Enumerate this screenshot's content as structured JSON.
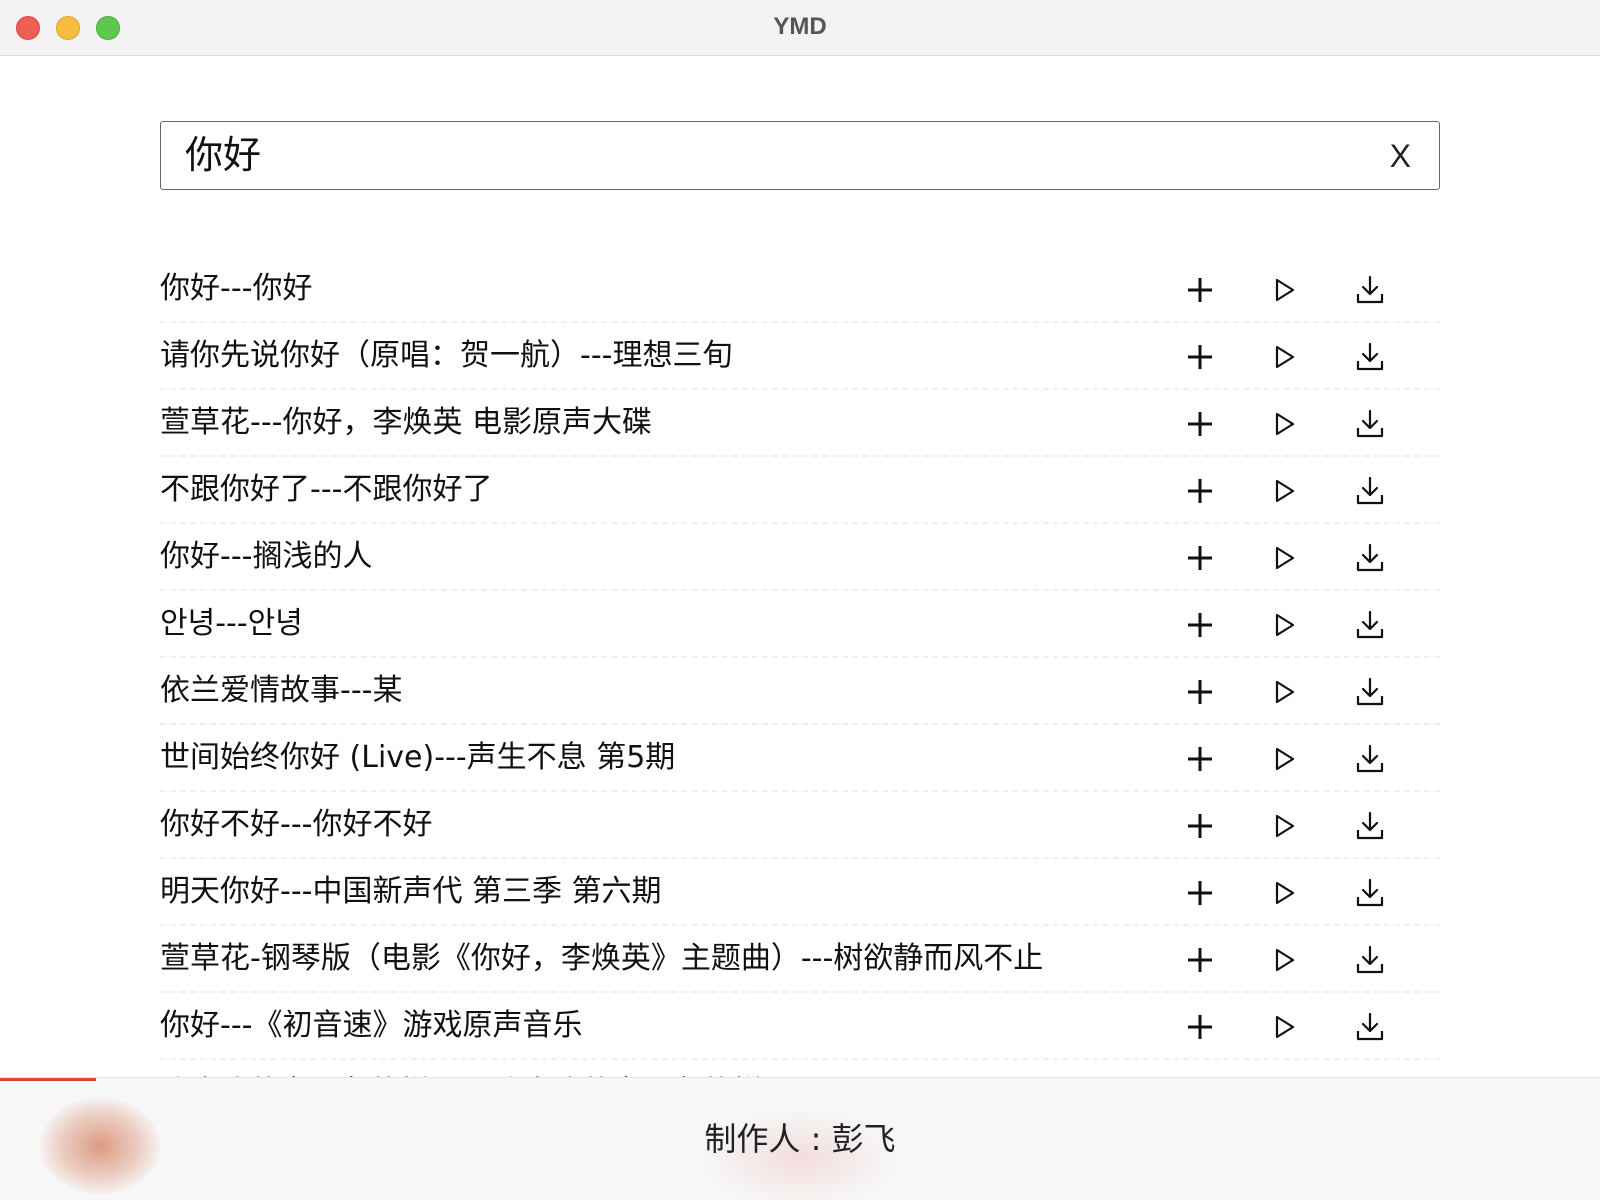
{
  "window": {
    "title": "YMD"
  },
  "search": {
    "value": "你好",
    "clear_label": "X"
  },
  "results": [
    {
      "label": "你好---你好"
    },
    {
      "label": "请你先说你好（原唱：贺一航）---理想三旬"
    },
    {
      "label": "萱草花---你好，李焕英 电影原声大碟"
    },
    {
      "label": "不跟你好了---不跟你好了"
    },
    {
      "label": "你好---搁浅的人"
    },
    {
      "label": "안녕---안녕"
    },
    {
      "label": "依兰爱情故事---某"
    },
    {
      "label": "世间始终你好 (Live)---声生不息 第5期"
    },
    {
      "label": "你好不好---你好不好"
    },
    {
      "label": "明天你好---中国新声代 第三季 第六期"
    },
    {
      "label": "萱草花-钢琴版（电影《你好，李焕英》主题曲）---树欲静而风不止"
    },
    {
      "label": "你好---《初音速》游戏原声音乐"
    },
    {
      "label": "我喜欢的女朋友的样子---我喜欢的女朋友的样子"
    }
  ],
  "actions": {
    "add_icon": "plus-icon",
    "play_icon": "play-icon",
    "download_icon": "download-icon"
  },
  "footer": {
    "credit": "制作人 : 彭飞",
    "progress_fraction": 0.06,
    "progress_color": "#d9443b"
  }
}
